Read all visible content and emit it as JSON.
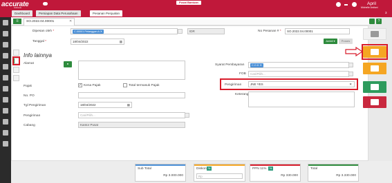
{
  "app": {
    "logo_text": "accurate",
    "logo_sub": "Indonesia",
    "center_button": "Pusat Bantuan",
    "user_name": "April",
    "user_sub": "Michelle Ardiani",
    "tab_count": "3"
  },
  "tabs": [
    "Dashboard",
    "Persiapan Data Perusahaan",
    "Pesanan Penjualan"
  ],
  "document_tab": "SO.2022.04.00001",
  "form": {
    "dipesan_oleh_label": "Dipesan oleh",
    "customer_chip": "C.00001 Pelanggan A",
    "currency": "IDR",
    "no_pesanan_label": "No Pesanan #",
    "no_pesanan_value": "SO.2022.04.00001",
    "tanggal_label": "Tanggal",
    "tanggal_value": "18/04/2022",
    "btn_ambil": "Ambil",
    "btn_proses": "Proses"
  },
  "info": {
    "title": "Info lainnya",
    "alamat_label": "Alamat",
    "pajak_label": "Pajak",
    "kena_pajak": "Kena Pajak",
    "total_termasuk_pajak": "Total termasuk Pajak",
    "no_po_label": "No. PO",
    "tgl_pengiriman_label": "Tgl Pengiriman",
    "tgl_pengiriman_value": "18/04/2022",
    "pengiriman_label": "Pengiriman",
    "pengiriman_placeholder": "Cari/Pilih...",
    "cabang_label": "Cabang",
    "cabang_value": "Kantor Pusat",
    "syarat_label": "Syarat Pembayaran",
    "syarat_chip": "C.O.D",
    "fob_label": "FOB",
    "fob_placeholder": "Cari/Pilih...",
    "pengiriman2_label": "Pengiriman",
    "pengiriman2_value": "JNE YES",
    "keterangan_label": "Keterangan"
  },
  "footer": {
    "subtotal_label": "Sub Total",
    "subtotal_value": "Rp 3.000.000",
    "diskon_label": "Diskon",
    "diskon_badge": "%",
    "diskon_value": "Rp",
    "ppn_label": "PPN 11%",
    "ppn_badge": "%",
    "ppn_value": "Rp 330.000",
    "total_label": "Total",
    "total_value": "Rp 3.330.000"
  },
  "colors": {
    "brand": "#c0183a",
    "green": "#2e8b3d",
    "highlight": "#d81b2a",
    "orange": "#f5a623",
    "teal": "#2e9b5d",
    "danger": "#c9283e"
  }
}
